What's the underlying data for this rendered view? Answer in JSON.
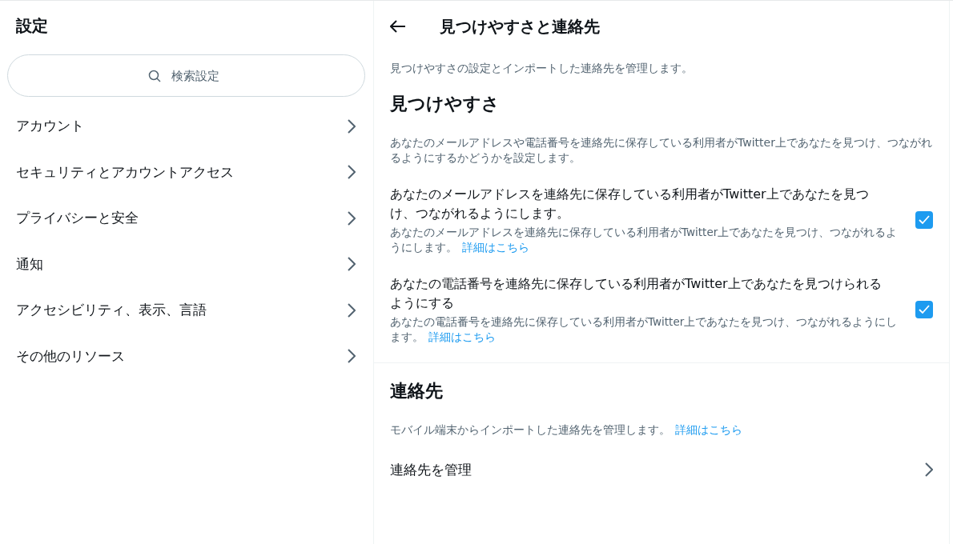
{
  "sidebar": {
    "title": "設定",
    "search": {
      "placeholder": "検索設定"
    },
    "items": [
      {
        "label": "アカウント"
      },
      {
        "label": "セキュリティとアカウントアクセス"
      },
      {
        "label": "プライバシーと安全"
      },
      {
        "label": "通知"
      },
      {
        "label": "アクセシビリティ、表示、言語"
      },
      {
        "label": "その他のリソース"
      }
    ]
  },
  "main": {
    "title": "見つけやすさと連絡先",
    "intro": "見つけやすさの設定とインポートした連絡先を管理します。",
    "sections": [
      {
        "title": "見つけやすさ",
        "description": "あなたのメールアドレスや電話番号を連絡先に保存している利用者がTwitter上であなたを見つけ、つながれるようにするかどうかを設定します。",
        "options": [
          {
            "label": "あなたのメールアドレスを連絡先に保存している利用者がTwitter上であなたを見つけ、つながれるようにします。",
            "help": "あなたのメールアドレスを連絡先に保存している利用者がTwitter上であなたを見つけ、つながれるようにします。",
            "link": "詳細はこちら",
            "checked": true
          },
          {
            "label": "あなたの電話番号を連絡先に保存している利用者がTwitter上であなたを見つけられるようにする",
            "help": "あなたの電話番号を連絡先に保存している利用者がTwitter上であなたを見つけ、つながれるようにします。",
            "link": "詳細はこちら",
            "checked": true
          }
        ]
      },
      {
        "title": "連絡先",
        "description": "モバイル端末からインポートした連絡先を管理します。",
        "link": "詳細はこちら",
        "rows": [
          {
            "label": "連絡先を管理"
          }
        ]
      }
    ]
  }
}
